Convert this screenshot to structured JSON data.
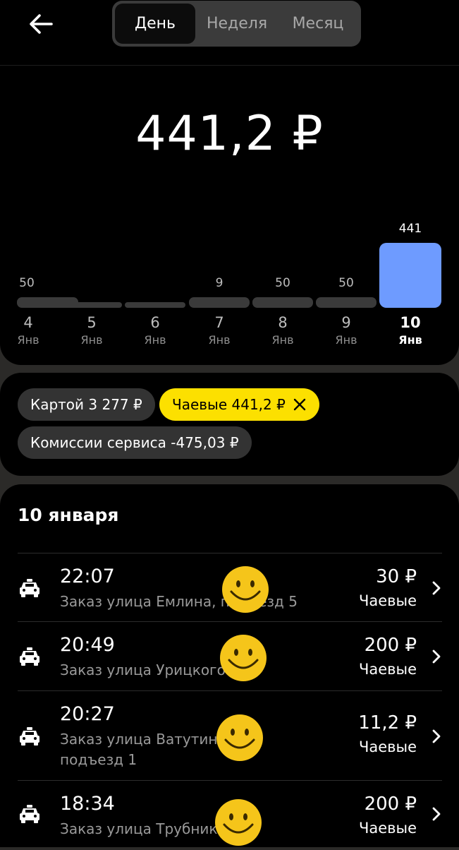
{
  "header": {
    "tabs": [
      {
        "label": "День",
        "active": true
      },
      {
        "label": "Неделя",
        "active": false
      },
      {
        "label": "Месяц",
        "active": false
      }
    ]
  },
  "total": "441,2 ₽",
  "chart_data": {
    "type": "bar",
    "categories": [
      "4 Янв",
      "5 Янв",
      "6 Янв",
      "7 Янв",
      "8 Янв",
      "9 Янв",
      "10 Янв"
    ],
    "days": [
      "4",
      "5",
      "6",
      "7",
      "8",
      "9",
      "10"
    ],
    "months": [
      "Янв",
      "Янв",
      "Янв",
      "Янв",
      "Янв",
      "Янв",
      "Янв"
    ],
    "values": [
      50,
      0,
      0,
      9,
      50,
      50,
      441
    ],
    "value_labels": [
      "50",
      "",
      "",
      "9",
      "50",
      "50",
      "441"
    ],
    "selected_index": 6,
    "colors": {
      "bar": "#3a3a3a",
      "selected": "#6e9bff"
    }
  },
  "filters": {
    "card": "Картой 3 277 ₽",
    "tips": "Чаевые 441,2 ₽",
    "commission": "Комиссии сервиса -475,03 ₽"
  },
  "list": {
    "date": "10 января",
    "rows": [
      {
        "time": "22:07",
        "address": "Заказ улица Емлина, подъезд 5",
        "amount": "30 ₽",
        "kind": "Чаевые"
      },
      {
        "time": "20:49",
        "address": "Заказ улица Урицкого",
        "amount": "200 ₽",
        "kind": "Чаевые"
      },
      {
        "time": "20:27",
        "address": "Заказ улица Ватутина, подъезд 1",
        "amount": "11,2 ₽",
        "kind": "Чаевые"
      },
      {
        "time": "18:34",
        "address": "Заказ улица Трубников",
        "amount": "200 ₽",
        "kind": "Чаевые"
      }
    ]
  },
  "colors": {
    "accent": "#fce000",
    "background": "#000000"
  }
}
